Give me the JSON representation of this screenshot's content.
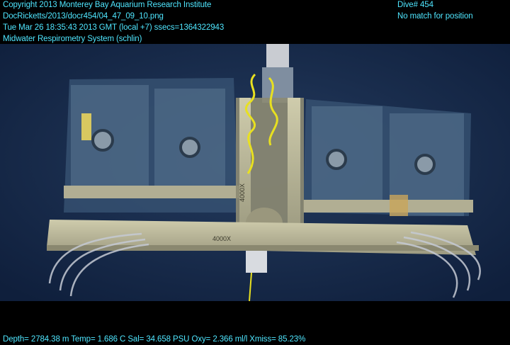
{
  "overlay": {
    "header_left": [
      "Copyright 2013 Monterey Bay Aquarium Research Institute",
      "DocRicketts/2013/docr454/04_47_09_10.png",
      "Tue Mar 26 18:35:43 2013 GMT (local +7)  ssecs=1364322943",
      "Midwater Respirometry System (schlin)"
    ],
    "header_right": [
      "Dive# 454",
      "No match for position"
    ],
    "footer": "Depth= 2784.38 m  Temp= 1.686 C  Sal= 34.658 PSU  Oxy= 2.366 ml/l  Xmiss= 85.23%"
  },
  "scene": {
    "apparatus_labels": [
      "4000X",
      "4000X"
    ],
    "colors": {
      "water": "#16294a",
      "frame": "#b8b69a",
      "rope": "#e8e020",
      "overlay_text": "#4fe6ff"
    }
  }
}
